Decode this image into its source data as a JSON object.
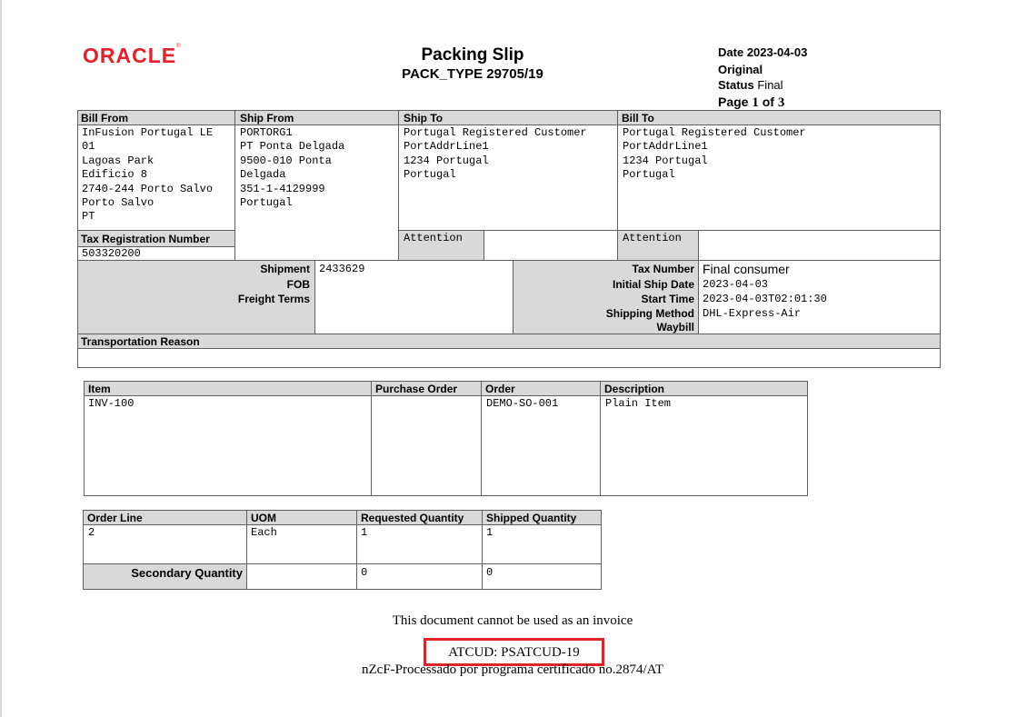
{
  "header": {
    "logo_text": "ORACLE",
    "logo_mark": "®",
    "title": "Packing Slip",
    "subtitle": "PACK_TYPE 29705/19",
    "date_label": "Date",
    "date_value": "2023-04-03",
    "copy_label": "Original",
    "status_label": "Status",
    "status_value": "Final",
    "page_label": "Page",
    "page_current": "1",
    "page_of": "of",
    "page_total": "3"
  },
  "addresses": {
    "bill_from_label": "Bill From",
    "bill_from": "InFusion Portugal LE\n01\nLagoas Park\nEdificio 8\n2740-244 Porto Salvo\nPorto Salvo\nPT",
    "ship_from_label": "Ship From",
    "ship_from": "PORTORG1\nPT Ponta Delgada\n9500-010 Ponta\nDelgada\n351-1-4129999\nPortugal",
    "ship_to_label": "Ship To",
    "ship_to": "Portugal Registered Customer\nPortAddrLine1\n1234 Portugal\nPortugal",
    "bill_to_label": "Bill To",
    "bill_to": "Portugal Registered Customer\nPortAddrLine1\n1234 Portugal\nPortugal",
    "tax_reg_label": "Tax Registration Number",
    "tax_reg_value": "503320200",
    "attention_label_1": "Attention",
    "attention_label_2": "Attention"
  },
  "shipment": {
    "shipment_label": "Shipment",
    "shipment_value": "2433629",
    "fob_label": "FOB",
    "freight_label": "Freight Terms",
    "tax_number_label": "Tax Number",
    "tax_number_value": "Final consumer",
    "initial_ship_date_label": "Initial Ship Date",
    "initial_ship_date_value": "2023-04-03",
    "start_time_label": "Start Time",
    "start_time_value": "2023-04-03T02:01:30",
    "shipping_method_label": "Shipping Method",
    "shipping_method_value": "DHL-Express-Air",
    "waybill_label": "Waybill",
    "transport_reason_label": "Transportation Reason"
  },
  "items_table": {
    "headers": [
      "Item",
      "Purchase Order",
      "Order",
      "Description"
    ],
    "row": [
      "INV-100",
      "",
      "DEMO-SO-001",
      "Plain Item"
    ]
  },
  "lines_table": {
    "headers": [
      "Order Line",
      "UOM",
      "Requested Quantity",
      "Shipped Quantity"
    ],
    "row": [
      "2",
      "Each",
      "1",
      "1"
    ],
    "secondary_label": "Secondary Quantity",
    "secondary_requested": "0",
    "secondary_shipped": "0"
  },
  "footer": {
    "notice": "This document cannot be used as an invoice",
    "atcud": "ATCUD: PSATCUD-19",
    "certification": "nZcF-Processado por programa certificado no.2874/AT"
  }
}
